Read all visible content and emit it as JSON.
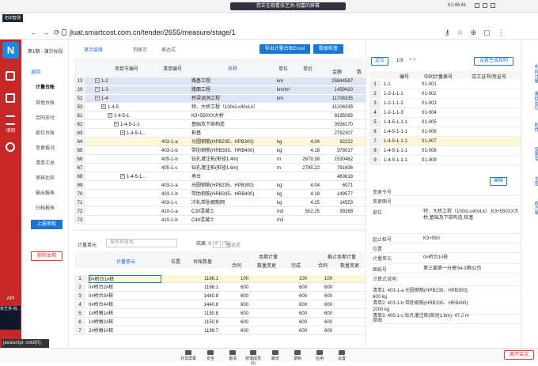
{
  "topbar": {
    "share_text": "您正在观看张艺洪-倪嘉的屏幕",
    "time": "01:46:41",
    "mode_label": "演讲者视图"
  },
  "browser": {
    "tab_label": "初识智测",
    "url": "jluat.smartcost.com.cn/tender/2655/measure/stage/1"
  },
  "sidebar": {
    "items": [
      {
        "label": "",
        "icon": "check-icon"
      },
      {
        "label": "",
        "icon": "grid-icon"
      },
      {
        "label": "项目",
        "icon": "list-icon"
      },
      {
        "label": "",
        "icon": "org-icon"
      }
    ],
    "api_label": "API",
    "video_label": "张艺洪-倪..."
  },
  "nav": {
    "stage_title": "第1期 - 演示标段",
    "back": "返回",
    "items": [
      "计量台账",
      "其他台账",
      "合同支付",
      "部位台账",
      "变更报况",
      "清单汇总",
      "审核比较",
      "输出报表",
      "归档报表"
    ],
    "active": "计量台账",
    "report_button": "上报审批",
    "delete_button": "删除本期"
  },
  "toolbar": {
    "display_level": "显示层级",
    "list_display": "列显示",
    "expression": "表达式",
    "export_button": "导出计量台账Excel",
    "check_button": "数据检查"
  },
  "ledger": {
    "headers": [
      "项目节编号",
      "清单编号",
      "名称",
      "单位",
      "单价",
      "金额",
      "数"
    ],
    "rows": [
      {
        "n": "13",
        "code": "1-2",
        "bill": "",
        "name": "路基工程",
        "unit": "km",
        "price": "",
        "amount": "25844587",
        "style": "hl",
        "indent": 1,
        "plus": true
      },
      {
        "n": "29",
        "code": "1-3",
        "bill": "",
        "name": "路面工程",
        "unit": "km/m²",
        "price": "",
        "amount": "1459420",
        "style": "hl",
        "indent": 1,
        "plus": true
      },
      {
        "n": "52",
        "code": "1-4",
        "bill": "",
        "name": "桥梁涵洞工程",
        "unit": "km",
        "price": "",
        "amount": "11706335",
        "style": "hl",
        "indent": 1,
        "plus": true
      },
      {
        "n": "53",
        "code": "1-4-5",
        "bill": "",
        "name": "特、大桥工程（100≤L≤40≤Lk）",
        "unit": "",
        "price": "",
        "amount": "11206335",
        "style": "",
        "indent": 2,
        "plus": true
      },
      {
        "n": "61",
        "code": "1-4-5-1",
        "bill": "",
        "name": "K3+550XX大桥",
        "unit": "",
        "price": "",
        "amount": "8195085",
        "style": "",
        "indent": 3,
        "plus": true
      },
      {
        "n": "62",
        "code": "1-4-5-1-1",
        "bill": "",
        "name": "基础及下部构造",
        "unit": "",
        "price": "",
        "amount": "3936170",
        "style": "",
        "indent": 4,
        "plus": true
      },
      {
        "n": "63",
        "code": "1-4-5-1...",
        "bill": "",
        "name": "桩基",
        "unit": "",
        "price": "",
        "amount": "2792307",
        "style": "",
        "indent": 5,
        "plus": true
      },
      {
        "n": "64",
        "code": "",
        "bill": "403-1-a",
        "name": "光圆钢筋(HPB235、HPB300)",
        "unit": "kg",
        "price": "4.04",
        "amount": "92222",
        "style": "sel",
        "indent": 0,
        "plus": false
      },
      {
        "n": "65",
        "code": "",
        "bill": "403-1-b",
        "name": "带肋钢筋(HRB335、HRB400)",
        "unit": "kg",
        "price": "4.18",
        "amount": "378017",
        "style": "",
        "indent": 0,
        "plus": false
      },
      {
        "n": "66",
        "code": "",
        "bill": "405-1-b",
        "name": "钻孔灌注桩(桩径1.4m)",
        "unit": "m",
        "price": "2679.38",
        "amount": "1530462",
        "style": "",
        "indent": 0,
        "plus": false
      },
      {
        "n": "67",
        "code": "",
        "bill": "405-1-c",
        "name": "钻孔灌注桩(桩径1.6m)",
        "unit": "m",
        "price": "2795.22",
        "amount": "791606",
        "style": "",
        "indent": 0,
        "plus": false
      },
      {
        "n": "68",
        "code": "1-4-5-1...",
        "bill": "",
        "name": "承台",
        "unit": "",
        "price": "",
        "amount": "460618",
        "style": "",
        "indent": 5,
        "plus": true
      },
      {
        "n": "69",
        "code": "",
        "bill": "403-1-a",
        "name": "光圆钢筋(HPB235、HPB300)",
        "unit": "kg",
        "price": "4.04",
        "amount": "6071",
        "style": "",
        "indent": 0,
        "plus": false
      },
      {
        "n": "70",
        "code": "",
        "bill": "403-1-b",
        "name": "带肋钢筋(HRB335、HRB400)",
        "unit": "kg",
        "price": "4.18",
        "amount": "149577",
        "style": "",
        "indent": 0,
        "plus": false
      },
      {
        "n": "71",
        "code": "",
        "bill": "403-1-c",
        "name": "冷轧带肋钢筋网",
        "unit": "kg",
        "price": "4.25",
        "amount": "14553",
        "style": "",
        "indent": 0,
        "plus": false
      },
      {
        "n": "72",
        "code": "",
        "bill": "410-1-a",
        "name": "C30混凝土",
        "unit": "m3",
        "price": "502.25",
        "amount": "99268",
        "style": "",
        "indent": 0,
        "plus": false
      },
      {
        "n": "73",
        "code": "",
        "bill": "410-1-b",
        "name": "C40混凝土",
        "unit": "m3",
        "price": "",
        "amount": "",
        "style": "",
        "indent": 0,
        "plus": false
      }
    ]
  },
  "measure": {
    "title": "计量单元",
    "search_placeholder": "按名称查找",
    "result_label": "结果: 0",
    "expression": "表达式",
    "headers": {
      "unit": "计量单元",
      "position": "位置",
      "ledger_qty": "台账数量",
      "current": "本期计量",
      "contract": "合同",
      "change": "数量变更",
      "complete": "完成",
      "cumulative": "截止本期计量",
      "cum_contract": "合同",
      "cum_change": "数量变更"
    },
    "rows": [
      {
        "n": "1",
        "name": "0#桥台1#桩",
        "qty": "1166.1",
        "c": "100",
        "ch": "",
        "done": "100",
        "cc": "100",
        "cch": "",
        "sel": true
      },
      {
        "n": "2",
        "name": "0#桥台2#桩",
        "qty": "1166.1",
        "c": "600",
        "ch": "",
        "done": "600",
        "cc": "600",
        "cch": "",
        "sel": false
      },
      {
        "n": "3",
        "name": "0#桥台3#桩",
        "qty": "1440.8",
        "c": "600",
        "ch": "",
        "done": "600",
        "cc": "600",
        "cch": "",
        "sel": false
      },
      {
        "n": "4",
        "name": "0#桥台4#桩",
        "qty": "1440.8",
        "c": "600",
        "ch": "",
        "done": "600",
        "cc": "600",
        "cch": "",
        "sel": false
      },
      {
        "n": "5",
        "name": "1#桥墩1#桩",
        "qty": "1150.8",
        "c": "600",
        "ch": "",
        "done": "600",
        "cc": "600",
        "cch": "",
        "sel": false
      },
      {
        "n": "6",
        "name": "1#桥墩2#桩",
        "qty": "1150.8",
        "c": "600",
        "ch": "",
        "done": "600",
        "cc": "600",
        "cch": "",
        "sel": false
      },
      {
        "n": "7",
        "name": "2#桥墩1#桩",
        "qty": "1199.7",
        "c": "600",
        "ch": "",
        "done": "600",
        "cc": "600",
        "cch": "",
        "sel": false
      }
    ]
  },
  "right": {
    "locate_button": "定位",
    "page": "1/3",
    "summary_button": "设置生成规则",
    "headers": [
      "编号",
      "中间计量表号",
      "交工证书/凭证号"
    ],
    "rows": [
      {
        "n": "1",
        "code": "1-1",
        "sheet": "01-001"
      },
      {
        "n": "2",
        "code": "1-2-1-1-1",
        "sheet": "01-002"
      },
      {
        "n": "3",
        "code": "1-2-1-1-2",
        "sheet": "01-003"
      },
      {
        "n": "4",
        "code": "1-2-1-1-3",
        "sheet": "01-004"
      },
      {
        "n": "5",
        "code": "1-4-5-1-1-1",
        "sheet": "01-005"
      },
      {
        "n": "6",
        "code": "1-4-5-1-1-1",
        "sheet": "01-006"
      },
      {
        "n": "7",
        "code": "1-4-5-1-1-1",
        "sheet": "01-007",
        "sel": true
      },
      {
        "n": "8",
        "code": "1-4-5-1-1-1",
        "sheet": "01-008"
      },
      {
        "n": "9",
        "code": "1-4-5-1-1-1",
        "sheet": "01-009"
      }
    ],
    "edit_button": "编辑",
    "detail": [
      {
        "label": "变更令号",
        "value": ""
      },
      {
        "label": "变更图号",
        "value": ""
      },
      {
        "label": "部位",
        "value": "特、大桥工程（100≤L≤40≤Lk）,K3+550XX大桥,基础及下部构造,桩基"
      },
      {
        "label": "起止桩号",
        "value": "K3+550"
      },
      {
        "label": "位置",
        "value": ""
      },
      {
        "label": "计量单元",
        "value": "0#桥台1#桩"
      },
      {
        "label": "图纸号",
        "value": "第三篇第一分册S4-3第82页"
      },
      {
        "label": "计算式说明",
        "value": ""
      },
      {
        "label": "",
        "value": "清单1: 403-1-a 光圆钢筋(HPB235、HPB300): 600 kg\n清单2: 403-1-b 带肋钢筋(HRB335、HRB400): 2000 kg\n清单3: 405-1-c 钻孔灌注桩(桩径1.6m): 47.2 m"
      },
      {
        "label": "草图",
        "value": ""
      }
    ]
  },
  "farright": {
    "items": [
      "中间计量",
      "查找定位",
      "附件",
      "变更令",
      "书签",
      "收方单"
    ]
  },
  "bottom": {
    "js_status": "javascript: void(0);",
    "items": [
      "共享屏幕",
      "安全",
      "邀请",
      "管理成员(6)",
      "聊天",
      "录制",
      "应用",
      "设置"
    ],
    "leave": "离开会议"
  }
}
